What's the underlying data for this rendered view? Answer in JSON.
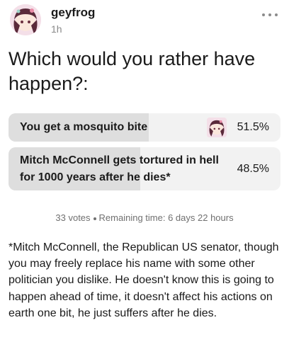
{
  "post": {
    "username": "geyfrog",
    "timestamp": "1h",
    "more_icon": "ellipsis-icon"
  },
  "poll": {
    "question": "Which would you rather have happen?:",
    "options": [
      {
        "label": "You get a mosquito bite",
        "percent": "51.5%",
        "fill": 0.515,
        "voted": true
      },
      {
        "label": "Mitch McConnell gets tortured in hell for 1000 years after he dies*",
        "percent": "48.5%",
        "fill": 0.485,
        "voted": false
      }
    ],
    "votes": "33 votes",
    "remaining": "Remaining time: 6 days 22 hours"
  },
  "footnote": "*Mitch McConnell, the Republican US senator, though you may freely replace his name with some other politician you dislike. He doesn't know this is going to happen ahead of time, it doesn't affect his actions on earth one bit, he just suffers after he dies."
}
